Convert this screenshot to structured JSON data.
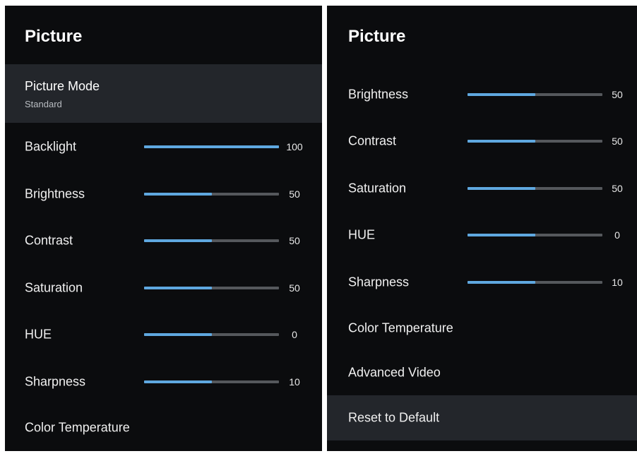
{
  "colors": {
    "accent": "#5fa8e0",
    "track": "#55585c",
    "panel_bg": "#0b0c0e",
    "selected_bg": "#23262b"
  },
  "left": {
    "title": "Picture",
    "picture_mode": {
      "label": "Picture Mode",
      "value": "Standard"
    },
    "sliders": [
      {
        "label": "Backlight",
        "value": "100",
        "level": 1.0
      },
      {
        "label": "Brightness",
        "value": "50",
        "level": 0.5
      },
      {
        "label": "Contrast",
        "value": "50",
        "level": 0.5
      },
      {
        "label": "Saturation",
        "value": "50",
        "level": 0.5
      },
      {
        "label": "HUE",
        "value": "0",
        "level": 0.5
      },
      {
        "label": "Sharpness",
        "value": "10",
        "level": 0.5
      }
    ],
    "items": [
      {
        "label": "Color Temperature"
      }
    ]
  },
  "right": {
    "title": "Picture",
    "sliders": [
      {
        "label": "Brightness",
        "value": "50",
        "level": 0.5
      },
      {
        "label": "Contrast",
        "value": "50",
        "level": 0.5
      },
      {
        "label": "Saturation",
        "value": "50",
        "level": 0.5
      },
      {
        "label": "HUE",
        "value": "0",
        "level": 0.5
      },
      {
        "label": "Sharpness",
        "value": "10",
        "level": 0.5
      }
    ],
    "items": [
      {
        "label": "Color Temperature"
      },
      {
        "label": "Advanced Video"
      },
      {
        "label": "Reset to Default"
      }
    ]
  }
}
